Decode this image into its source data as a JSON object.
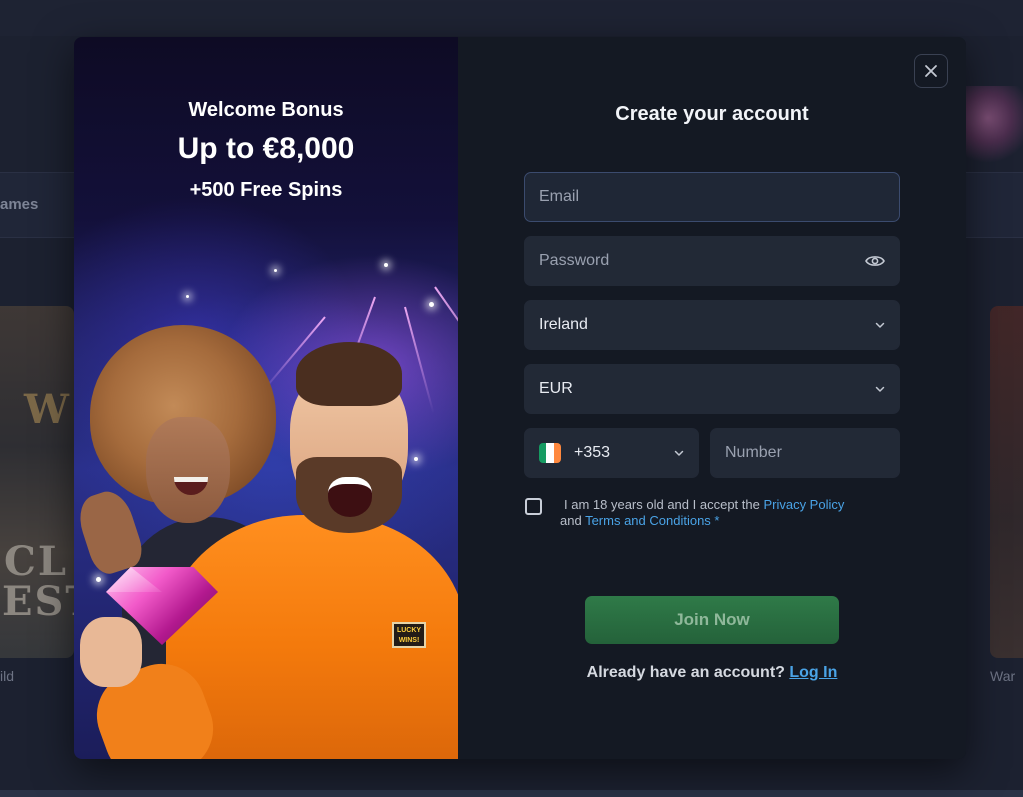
{
  "background": {
    "nav_partial_text": "ames",
    "tile_left_caption": "ild",
    "tile_right_caption": "War"
  },
  "promo": {
    "line1": "Welcome Bonus",
    "line2": "Up to €8,000",
    "line3": "+500 Free Spins",
    "sweater_badge": "LUCKY WINS!"
  },
  "form": {
    "title": "Create your account",
    "email_placeholder": "Email",
    "password_placeholder": "Password",
    "country_value": "Ireland",
    "currency_value": "EUR",
    "phone_code": "+353",
    "number_placeholder": "Number",
    "consent": {
      "text_before": "I am 18 years old and I accept the ",
      "privacy_link": "Privacy Policy",
      "text_middle": " and ",
      "terms_link": "Terms and Conditions",
      "required_mark": " *"
    },
    "join_button": "Join Now",
    "login_prompt": "Already have an account? ",
    "login_link": "Log In"
  },
  "icons": {
    "close": "close-icon",
    "password_toggle": "eye-icon",
    "dropdown": "chevron-down-icon",
    "flag": "ireland-flag-icon"
  },
  "colors": {
    "accent_link": "#4aa3e6",
    "join_button": "#2f7a48",
    "flag_green": "#169b62",
    "flag_white": "#ffffff",
    "flag_orange": "#ff883e"
  }
}
